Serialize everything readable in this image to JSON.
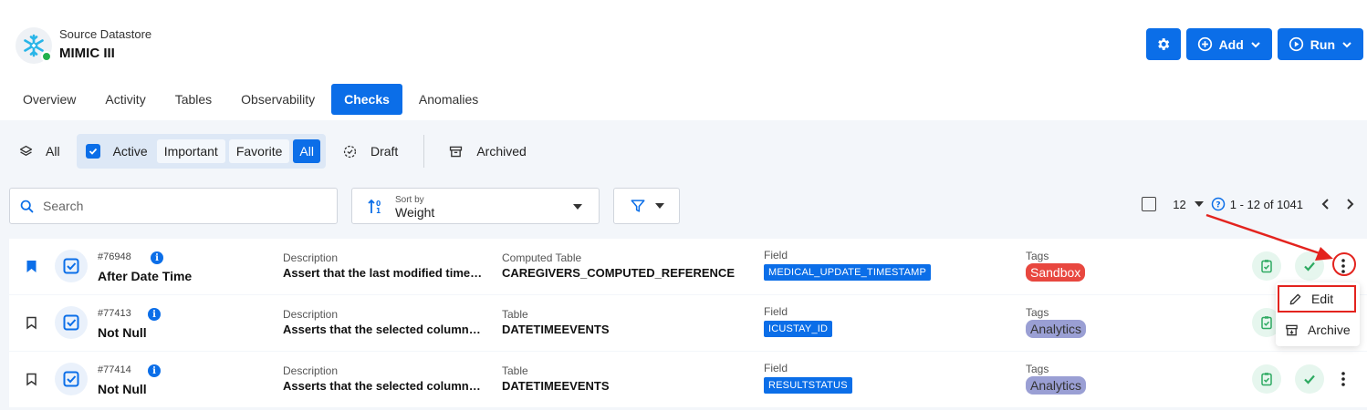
{
  "datastore": {
    "subtitle": "Source Datastore",
    "title": "MIMIC III",
    "logo_icon": "snowflake-icon",
    "status_color": "#22b14c"
  },
  "header_actions": {
    "settings_icon": "gear-icon",
    "add_label": "Add",
    "run_label": "Run"
  },
  "tabs": [
    {
      "label": "Overview",
      "active": false
    },
    {
      "label": "Activity",
      "active": false
    },
    {
      "label": "Tables",
      "active": false
    },
    {
      "label": "Observability",
      "active": false
    },
    {
      "label": "Checks",
      "active": true
    },
    {
      "label": "Anomalies",
      "active": false
    }
  ],
  "filters": {
    "all_label": "All",
    "active_label": "Active",
    "important_label": "Important",
    "favorite_label": "Favorite",
    "all_chip_label": "All",
    "draft_label": "Draft",
    "archived_label": "Archived"
  },
  "search": {
    "placeholder": "Search"
  },
  "sort": {
    "label": "Sort by",
    "value": "Weight"
  },
  "pagination": {
    "per_page": "12",
    "range": "1 - 12 of 1041"
  },
  "rows": [
    {
      "id": "#76948",
      "name": "After Date Time",
      "bookmarked": true,
      "desc_label": "Description",
      "desc": "Assert that the last modified time…",
      "table_label": "Computed Table",
      "table": "CAREGIVERS_COMPUTED_REFERENCE",
      "field_label": "Field",
      "field": "MEDICAL_UPDATE_TIMESTAMP",
      "tags_label": "Tags",
      "tag": "Sandbox"
    },
    {
      "id": "#77413",
      "name": "Not Null",
      "bookmarked": false,
      "desc_label": "Description",
      "desc": "Asserts that the selected column…",
      "table_label": "Table",
      "table": "DATETIMEEVENTS",
      "field_label": "Field",
      "field": "ICUSTAY_ID",
      "tags_label": "Tags",
      "tag": "Analytics"
    },
    {
      "id": "#77414",
      "name": "Not Null",
      "bookmarked": false,
      "desc_label": "Description",
      "desc": "Asserts that the selected column…",
      "table_label": "Table",
      "table": "DATETIMEEVENTS",
      "field_label": "Field",
      "field": "RESULTSTATUS",
      "tags_label": "Tags",
      "tag": "Analytics"
    }
  ],
  "menu": {
    "edit_label": "Edit",
    "archive_label": "Archive"
  },
  "colors": {
    "accent": "#0b6ee8",
    "highlight": "#e3231e",
    "sandbox": "#e8473f",
    "analytics": "#9a9fd4"
  }
}
